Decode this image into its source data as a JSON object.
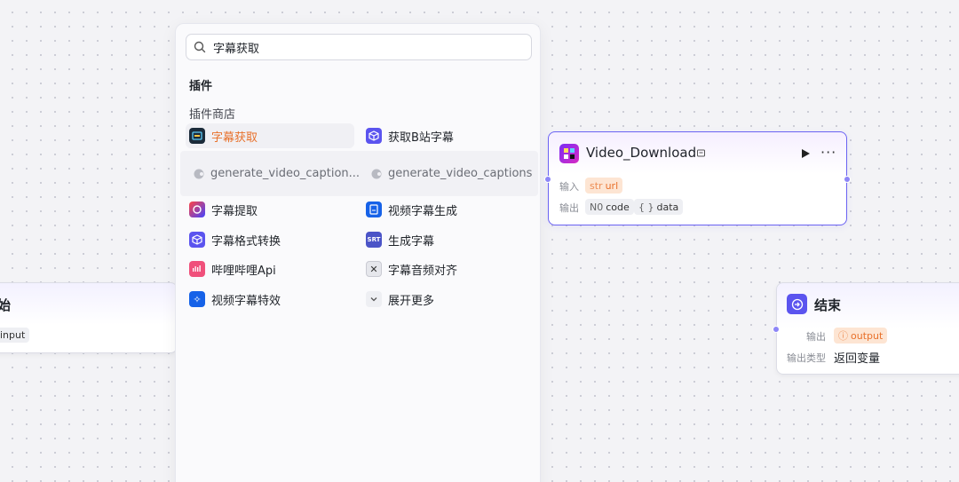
{
  "start_node": {
    "title": "始",
    "chip": "input"
  },
  "panel": {
    "search_value": "字幕获取",
    "section_title": "插件",
    "sub_title": "插件商店",
    "items": [
      {
        "label": "字幕获取",
        "icon": "subtitle-fetch-icon"
      },
      {
        "label": "获取B站字幕",
        "icon": "cube-icon"
      },
      {
        "label": "字幕提取",
        "icon": "subtitle-extract-icon"
      },
      {
        "label": "视频字幕生成",
        "icon": "video-subtitle-icon"
      },
      {
        "label": "字幕格式转换",
        "icon": "cube-icon"
      },
      {
        "label": "生成字幕",
        "icon": "srt-icon"
      },
      {
        "label": "哔哩哔哩Api",
        "icon": "bilibili-icon"
      },
      {
        "label": "字幕音频对齐",
        "icon": "close-box-icon"
      },
      {
        "label": "视频字幕特效",
        "icon": "sparkle-icon"
      },
      {
        "label": "展开更多",
        "icon": "chevron-down-icon"
      }
    ],
    "tools": [
      {
        "label": "generate_video_caption..."
      },
      {
        "label": "generate_video_captions"
      }
    ]
  },
  "video_node": {
    "title": "Video_Download",
    "input_label": "输入",
    "output_label": "输出",
    "input_param": {
      "type": "str",
      "name": "url"
    },
    "output_params": [
      {
        "type": "N0",
        "name": "code"
      },
      {
        "type": "{ }",
        "name": "data"
      }
    ]
  },
  "end_node": {
    "title": "结束",
    "output_label": "输出",
    "output_param": {
      "type": "ⓘ",
      "name": "output"
    },
    "output_type_label": "输出类型",
    "output_type_value": "返回变量"
  },
  "colors": {
    "accent": "#6b63f3",
    "orange": "#e8712b"
  }
}
